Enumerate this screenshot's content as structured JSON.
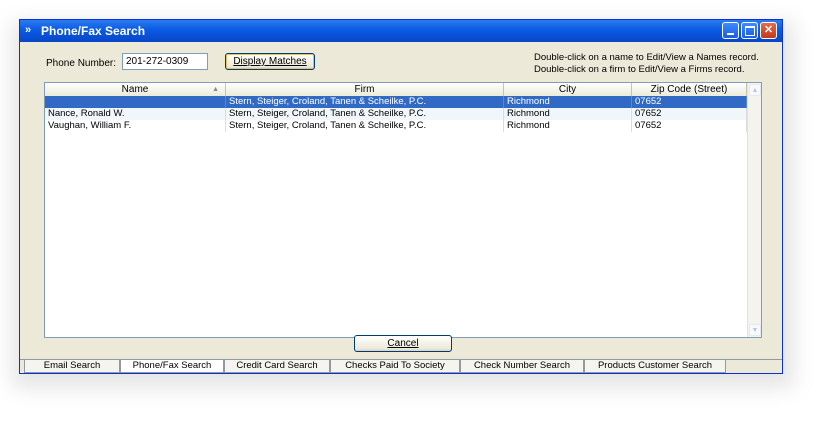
{
  "window": {
    "title": "Phone/Fax Search",
    "controls": {
      "minimize": "minimize",
      "maximize": "maximize",
      "close": "✕"
    }
  },
  "search": {
    "phone_label": "Phone Number:",
    "phone_value": "201-272-0309",
    "display_button": "Display Matches",
    "hint_names": "Double-click on a name to Edit/View a Names record.",
    "hint_firms": "Double-click on a firm to Edit/View a Firms record."
  },
  "grid": {
    "columns": [
      "Name",
      "Firm",
      "City",
      "Zip Code (Street)"
    ],
    "rows": [
      {
        "name": "",
        "firm": "Stern, Steiger, Croland, Tanen & Scheilke, P.C.",
        "city": "Richmond",
        "zip": "07652",
        "selected": true
      },
      {
        "name": "Nance, Ronald W.",
        "firm": "Stern, Steiger, Croland, Tanen & Scheilke, P.C.",
        "city": "Richmond",
        "zip": "07652",
        "selected": false
      },
      {
        "name": "Vaughan, William F.",
        "firm": "Stern, Steiger, Croland, Tanen & Scheilke, P.C.",
        "city": "Richmond",
        "zip": "07652",
        "selected": false
      }
    ]
  },
  "cancel_button": "Cancel",
  "tabs": [
    {
      "label": "Email Search",
      "active": false
    },
    {
      "label": "Phone/Fax Search",
      "active": true
    },
    {
      "label": "Credit Card Search",
      "active": false
    },
    {
      "label": "Checks Paid To Society",
      "active": false
    },
    {
      "label": "Check Number Search",
      "active": false
    },
    {
      "label": "Products Customer Search",
      "active": false
    }
  ],
  "colors": {
    "titlebar": "#0a5ae4",
    "selection": "#316ac5",
    "window_bg": "#ece9d8"
  }
}
